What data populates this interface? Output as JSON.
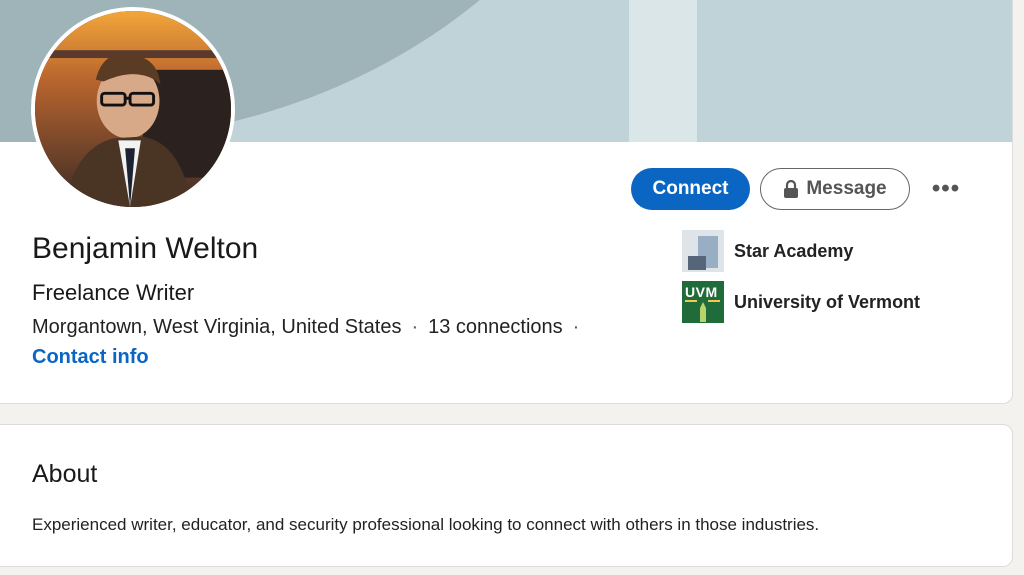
{
  "profile": {
    "name": "Benjamin Welton",
    "headline": "Freelance Writer",
    "location": "Morgantown, West Virginia, United States",
    "separator": "·",
    "connections": "13 connections",
    "contact_label": "Contact info",
    "avatar_icon": "profile-photo"
  },
  "actions": {
    "connect_label": "Connect",
    "message_label": "Message",
    "message_icon": "lock-icon",
    "more_label": "•••"
  },
  "organizations": [
    {
      "name": "Star Academy",
      "logo": "star-academy-logo"
    },
    {
      "name": "University of Vermont",
      "logo_text": "UVM",
      "logo": "uvm-logo"
    }
  ],
  "about": {
    "title": "About",
    "text": "Experienced writer, educator, and security professional looking to connect with others in those industries."
  },
  "colors": {
    "accent": "#0a66c2",
    "page_bg": "#f3f2ef",
    "banner": "#9fb4b8",
    "banner_light": "#bfd3d9"
  }
}
